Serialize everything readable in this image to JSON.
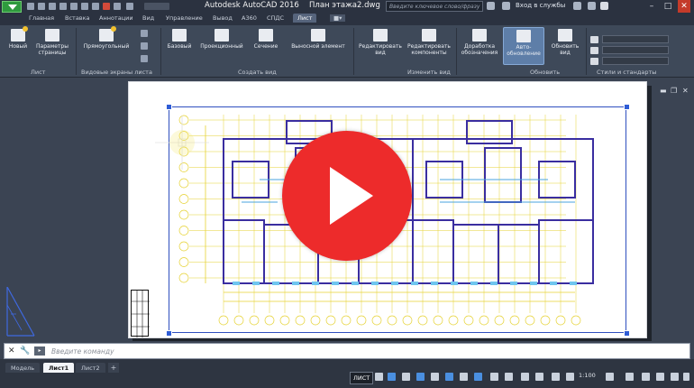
{
  "titlebar": {
    "app_title": "Autodesk AutoCAD 2016",
    "file_title": "План этажа2.dwg",
    "search_placeholder": "Введите ключевое слово/фразу",
    "signin": "Вход в службы"
  },
  "tabs": [
    {
      "label": "Главная"
    },
    {
      "label": "Вставка"
    },
    {
      "label": "Аннотации"
    },
    {
      "label": "Вид"
    },
    {
      "label": "Управление"
    },
    {
      "label": "Вывод"
    },
    {
      "label": "A360"
    },
    {
      "label": "СПДС"
    },
    {
      "label": "Лист"
    }
  ],
  "ribbon": {
    "list_panel": {
      "new": "Новый",
      "page_setup": "Параметры страницы",
      "label": "Лист"
    },
    "viewports_panel": {
      "rect": "Прямоугольный",
      "label": "Видовые экраны листа"
    },
    "create_view_panel": {
      "base": "Базовый",
      "projected": "Проекционный",
      "section": "Сечение",
      "detail": "Выносной элемент",
      "label": "Создать вид"
    },
    "modify_view_panel": {
      "edit_view": "Редактировать вид",
      "edit_components": "Редактировать компоненты",
      "label": "Изменить вид"
    },
    "update_panel": {
      "symbols": "Доработка обозначения",
      "auto_update": "Авто-обновление",
      "update_view": "Обновить вид",
      "label": "Обновить"
    },
    "styles_panel": {
      "label": "Стили и стандарты"
    }
  },
  "command": {
    "placeholder": "Введите команду"
  },
  "layout_tabs": [
    {
      "label": "Модель"
    },
    {
      "label": "Лист1"
    },
    {
      "label": "Лист2"
    }
  ],
  "status": {
    "space": "ЛИСТ",
    "scale": "1:100"
  },
  "drawing": {
    "axis_left": [
      "1",
      "2",
      "3",
      "4",
      "5",
      "6",
      "7",
      "8",
      "9",
      "10",
      "11"
    ],
    "axis_bottom": [
      "А",
      "Б",
      "В",
      "Г",
      "Д",
      "Е",
      "Ж",
      "И",
      "К",
      "Л",
      "М",
      "Н",
      "П",
      "Р",
      "С",
      "Т",
      "У",
      "Ф",
      "Х",
      "Ц",
      "Ч",
      "Ш",
      "Э",
      "Ю"
    ]
  },
  "colors": {
    "accent": "#2f5dd6",
    "play": "#ed2b2b",
    "app_green": "#2f9a3e",
    "wall_blue": "#3a2ea0",
    "dim_yellow": "#e6d233"
  }
}
